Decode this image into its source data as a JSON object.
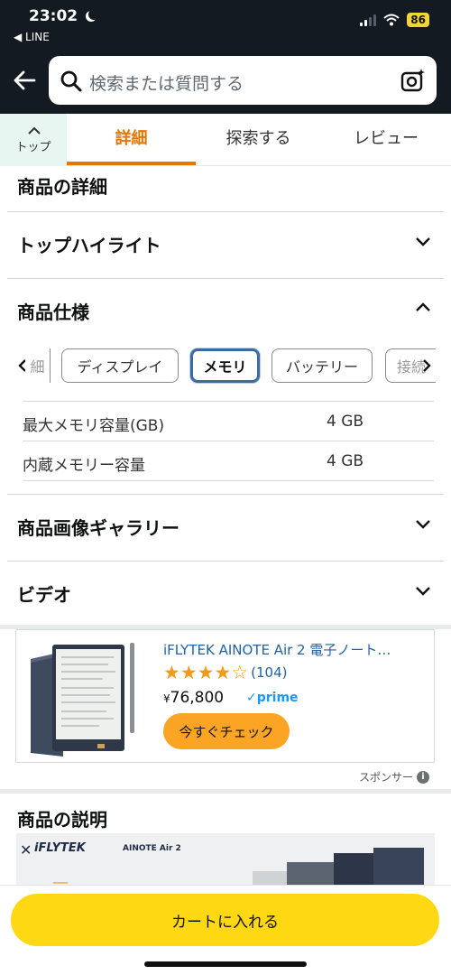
{
  "status_bar": {
    "time": "23:02",
    "back_app": "LINE",
    "battery": "86"
  },
  "header": {
    "search_placeholder": "検索または質問する"
  },
  "tabs": {
    "top": "トップ",
    "items": [
      "詳細",
      "探索する",
      "レビュー"
    ],
    "active": "詳細"
  },
  "details": {
    "heading": "商品の詳細",
    "sections": {
      "top_highlight": "トップハイライト",
      "specs": "商品仕様",
      "gallery": "商品画像ギャラリー",
      "video": "ビデオ"
    },
    "spec_chips": {
      "partial_left": "細",
      "display": "ディスプレイ",
      "memory": "メモリ",
      "battery": "バッテリー",
      "partial_right": "接続"
    },
    "selected_chip": "メモリ",
    "spec_rows": [
      {
        "label": "最大メモリ容量(GB)",
        "value": "4 GB"
      },
      {
        "label": "内蔵メモリー容量",
        "value": "4 GB"
      }
    ]
  },
  "ad": {
    "title": "iFLYTEK AINOTE Air 2 電子ノート…",
    "rating_stars": 4,
    "review_count": "(104)",
    "price_symbol": "¥",
    "price": "76,800",
    "prime": "✓prime",
    "cta": "今すぐチェック",
    "sponsor": "スポンサー"
  },
  "description": {
    "heading": "商品の説明",
    "brand": "iFLYTEK",
    "brand_sub": "AINOTE Air 2"
  },
  "bottom": {
    "add_to_cart": "カートに入れる"
  },
  "colors": {
    "header_bg": "#131a22",
    "accent": "#e77600",
    "cart_button": "#ffd814",
    "cta_button": "#fca524",
    "link": "#2162a1"
  }
}
